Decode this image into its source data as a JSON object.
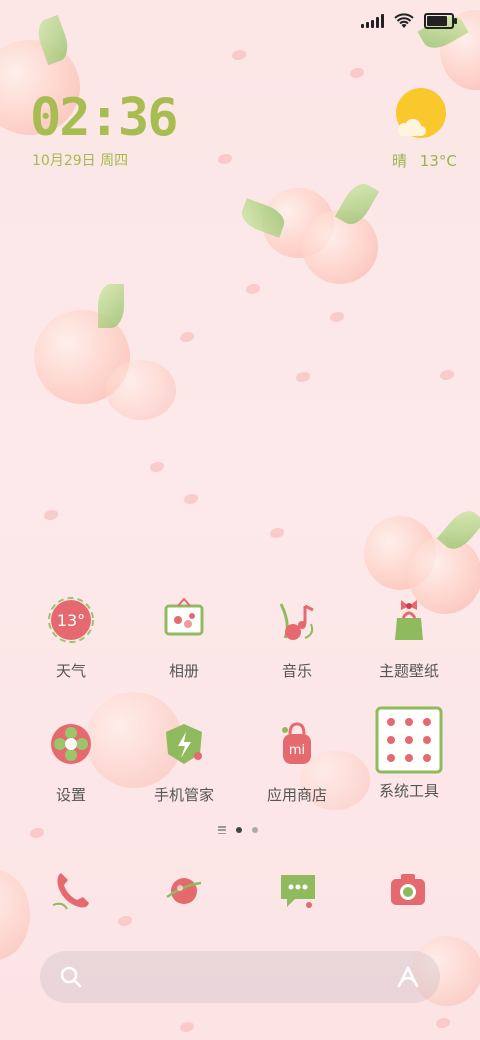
{
  "status_bar": {
    "icons": [
      "signal-icon",
      "wifi-icon",
      "battery-icon"
    ]
  },
  "clock": {
    "time": "02:36",
    "date": "10月29日 周四"
  },
  "weather": {
    "condition": "晴",
    "temperature": "13°C",
    "icon": "sunny-cloud-icon"
  },
  "apps": [
    {
      "label": "天气",
      "icon": "weather-icon",
      "badge": "13°"
    },
    {
      "label": "相册",
      "icon": "gallery-icon"
    },
    {
      "label": "音乐",
      "icon": "music-icon"
    },
    {
      "label": "主题壁纸",
      "icon": "themes-icon"
    },
    {
      "label": "设置",
      "icon": "settings-icon"
    },
    {
      "label": "手机管家",
      "icon": "security-icon"
    },
    {
      "label": "应用商店",
      "icon": "app-store-icon",
      "badge": "mi"
    },
    {
      "label": "系统工具",
      "icon": "system-tools-folder-icon"
    }
  ],
  "page_indicator": {
    "pages": 2,
    "current": 1
  },
  "dock": [
    {
      "icon": "phone-icon"
    },
    {
      "icon": "browser-icon"
    },
    {
      "icon": "messages-icon"
    },
    {
      "icon": "camera-icon"
    }
  ],
  "search": {
    "icons": [
      "search-icon",
      "assistant-icon"
    ]
  },
  "colors": {
    "accent_green": "#a7bd51",
    "peach": "#f6b1a6",
    "red": "#e56a6f",
    "leaf": "#93c06a"
  }
}
